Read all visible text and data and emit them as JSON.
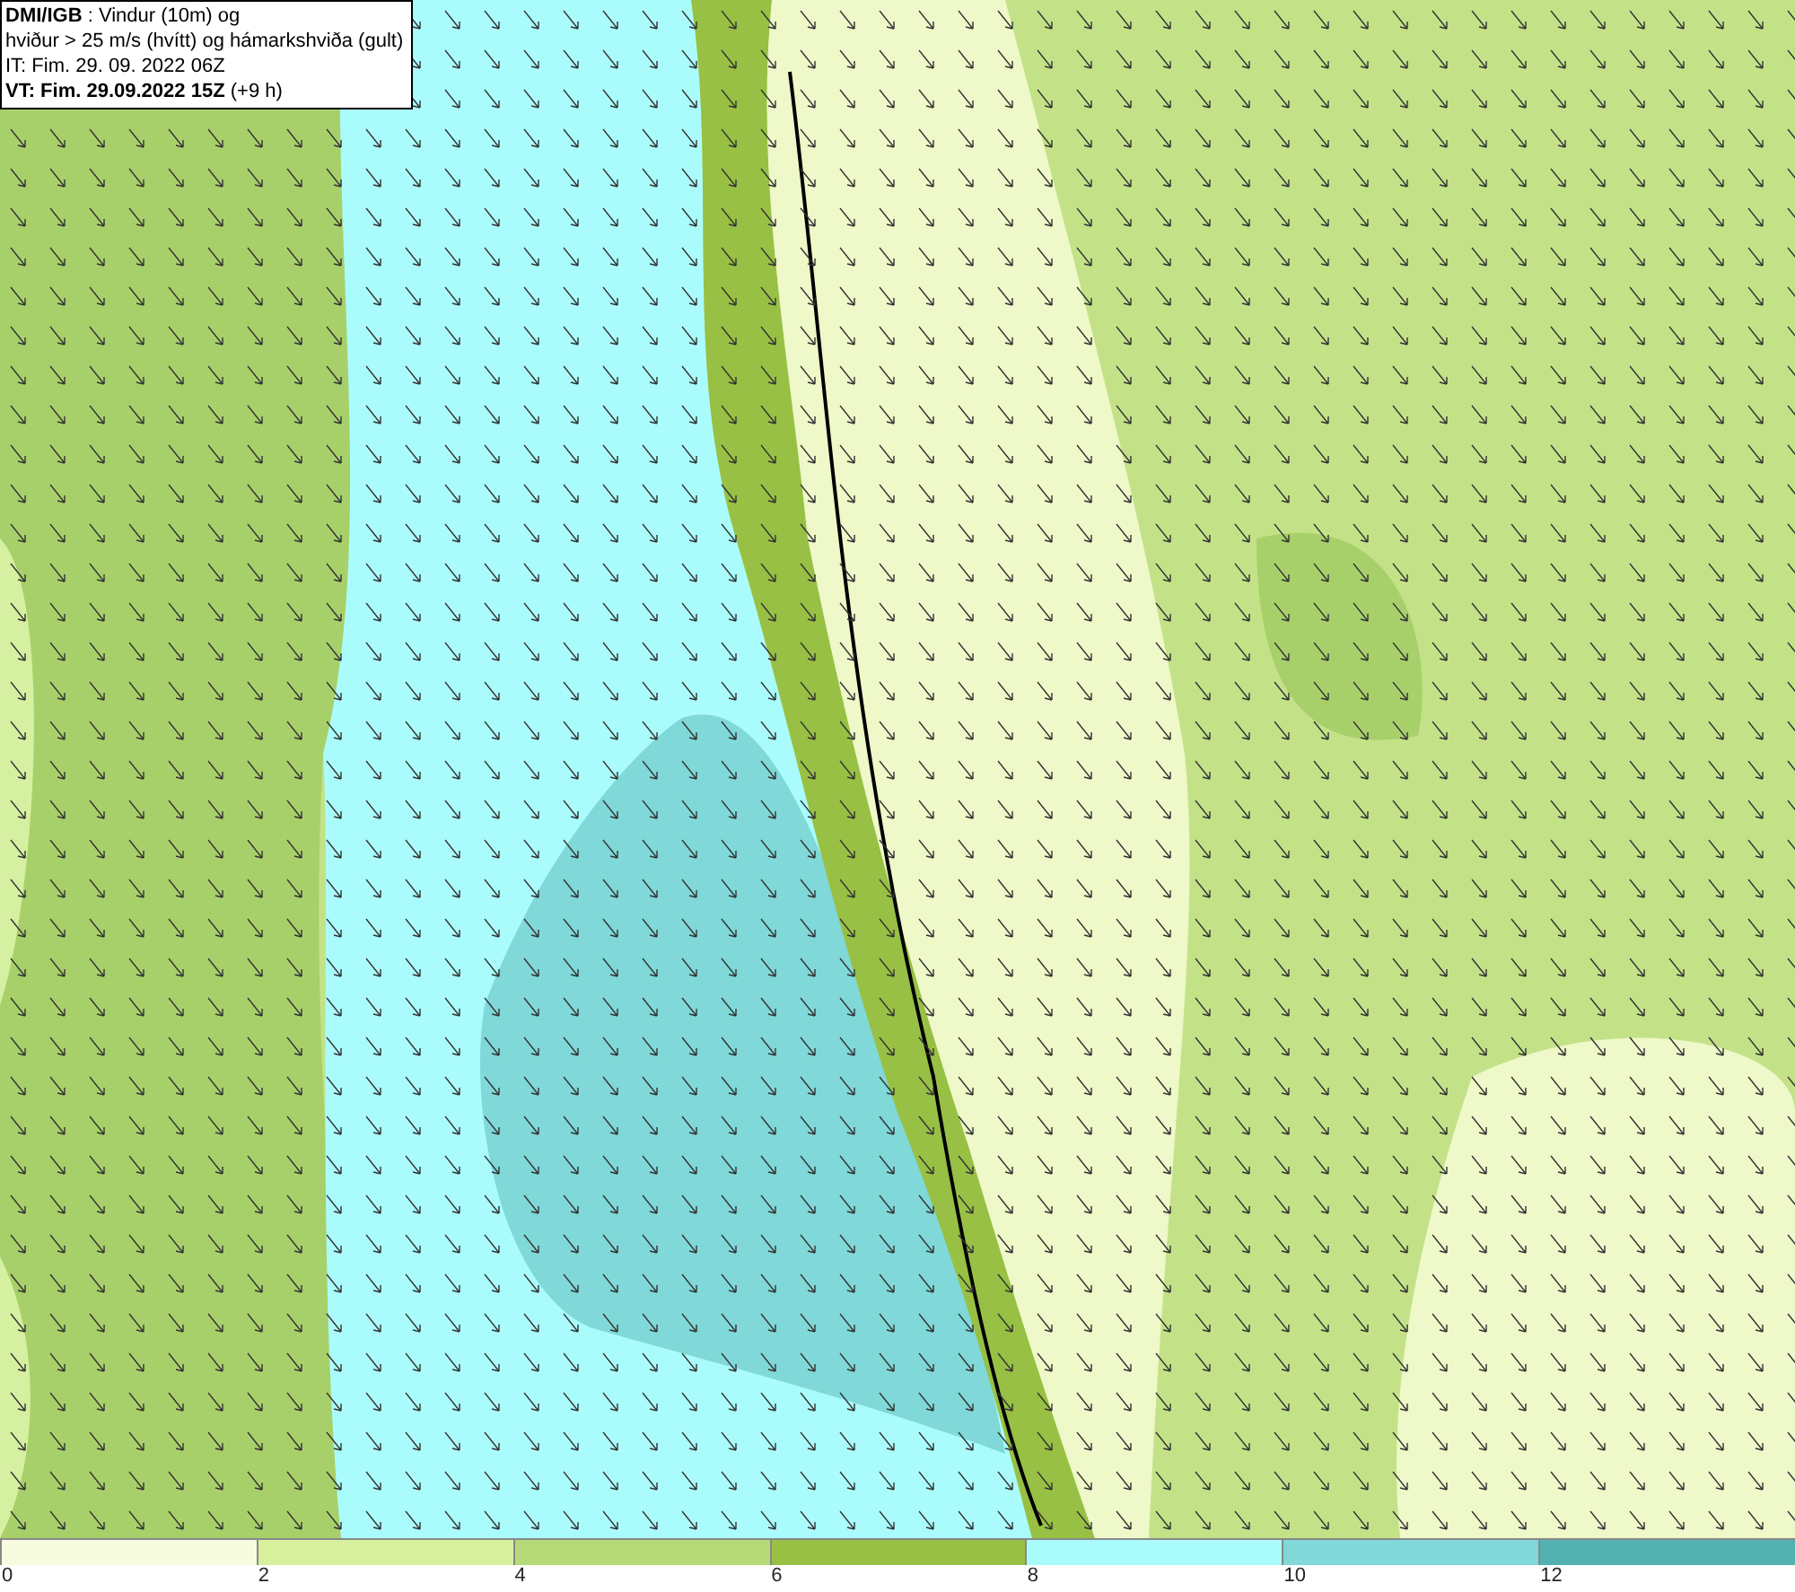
{
  "info_box": {
    "lines": [
      "**DMI/IGB** : Vindur (10m) og",
      "hviður > 25 m/s (hvítt) og hámarkshviða (gult)",
      "IT: Fim. 29. 09. 2022 06Z",
      "**VT: Fim. 29.09.2022 15Z** (+9 h)"
    ]
  },
  "legend": [
    {
      "label": "0",
      "color": "#f7fce0"
    },
    {
      "label": "2",
      "color": "#d6f09e"
    },
    {
      "label": "4",
      "color": "#b6da78"
    },
    {
      "label": "6",
      "color": "#98c044"
    },
    {
      "label": "8",
      "color": "#aafcfc"
    },
    {
      "label": "10",
      "color": "#80d8d8"
    },
    {
      "label": "12",
      "color": "#52b2b2"
    }
  ]
}
